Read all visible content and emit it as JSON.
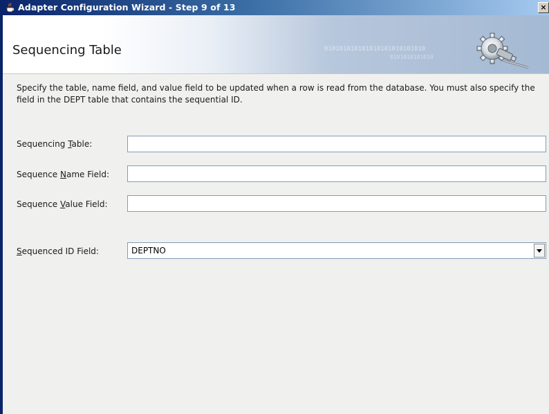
{
  "window": {
    "title": "Adapter Configuration Wizard - Step 9 of 13",
    "close_glyph": "×"
  },
  "header": {
    "title": "Sequencing Table",
    "binary_line1": "010101010101010101010101010",
    "binary_line2": "0101010101010"
  },
  "description": "Specify the table, name field, and value field to be updated when a row is read from the database.  You must also specify the field in the DEPT table that contains the sequential ID.",
  "fields": {
    "sequencing_table": {
      "pre": "Sequencing ",
      "mnemonic": "T",
      "post": "able:",
      "value": ""
    },
    "sequence_name": {
      "pre": "Sequence ",
      "mnemonic": "N",
      "post": "ame Field:",
      "value": ""
    },
    "sequence_value": {
      "pre": "Sequence ",
      "mnemonic": "V",
      "post": "alue Field:",
      "value": ""
    },
    "sequenced_id": {
      "pre": "",
      "mnemonic": "S",
      "post": "equenced ID Field:",
      "value": "DEPTNO"
    }
  },
  "colors": {
    "title_bar_start": "#0a246a",
    "title_bar_end": "#a6caf0",
    "panel_bg": "#f0f0ee",
    "input_border": "#7f9db9"
  },
  "icons": {
    "title": "java-coffee-cup-icon",
    "header": "gear-plug-icon",
    "close": "close-icon",
    "dropdown": "chevron-down-icon"
  }
}
